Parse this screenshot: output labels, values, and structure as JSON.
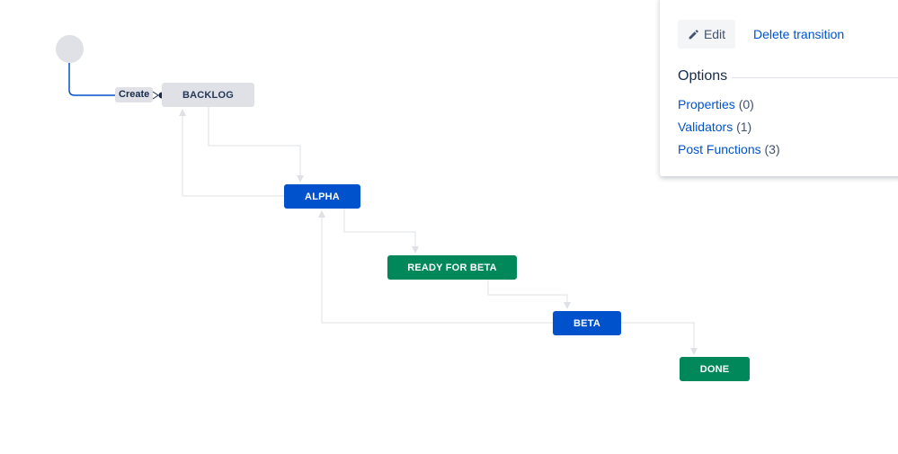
{
  "workflow": {
    "start": {},
    "create_transition": {
      "label": "Create"
    },
    "statuses": [
      {
        "id": "backlog",
        "label": "BACKLOG",
        "category": "todo",
        "color": "#dfe1e6",
        "text_color": "#253858"
      },
      {
        "id": "alpha",
        "label": "ALPHA",
        "category": "in-progress",
        "color": "#0052cc",
        "text_color": "#ffffff"
      },
      {
        "id": "ready",
        "label": "READY FOR BETA",
        "category": "done",
        "color": "#00875a",
        "text_color": "#ffffff"
      },
      {
        "id": "beta",
        "label": "BETA",
        "category": "in-progress",
        "color": "#0052cc",
        "text_color": "#ffffff"
      },
      {
        "id": "done",
        "label": "DONE",
        "category": "done",
        "color": "#00875a",
        "text_color": "#ffffff"
      }
    ],
    "transitions": [
      {
        "from": "start",
        "to": "backlog",
        "label": "Create",
        "selected": true
      },
      {
        "from": "backlog",
        "to": "alpha"
      },
      {
        "from": "alpha",
        "to": "backlog"
      },
      {
        "from": "alpha",
        "to": "ready"
      },
      {
        "from": "ready",
        "to": "beta"
      },
      {
        "from": "beta",
        "to": "alpha"
      },
      {
        "from": "beta",
        "to": "done"
      }
    ],
    "colors": {
      "selected_line": "#0052cc",
      "line": "#dfe1e6"
    }
  },
  "panel": {
    "edit_label": "Edit",
    "edit_icon": "pencil-icon",
    "delete_label": "Delete transition",
    "options_heading": "Options",
    "options": [
      {
        "label": "Properties",
        "count": "(0)"
      },
      {
        "label": "Validators",
        "count": "(1)"
      },
      {
        "label": "Post Functions",
        "count": "(3)"
      }
    ]
  }
}
